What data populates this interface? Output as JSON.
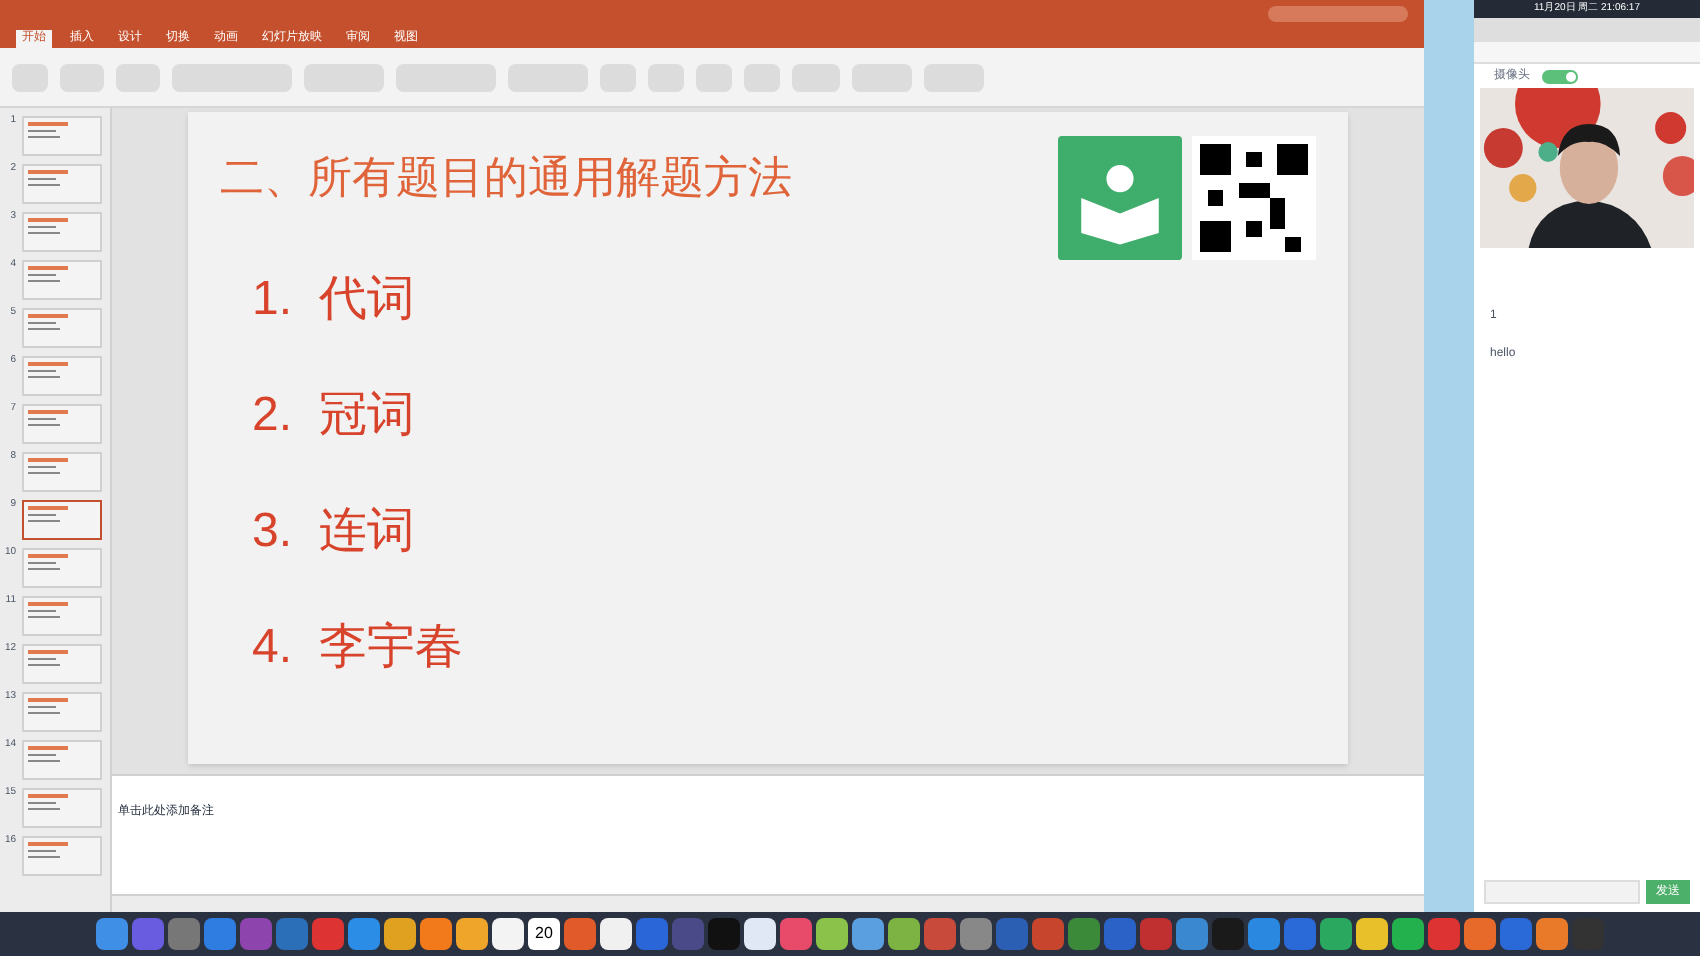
{
  "ribbon": {
    "tabs": [
      {
        "label": "开始",
        "selected": true
      },
      {
        "label": "插入",
        "selected": false
      },
      {
        "label": "设计",
        "selected": false
      },
      {
        "label": "切换",
        "selected": false
      },
      {
        "label": "动画",
        "selected": false
      },
      {
        "label": "幻灯片放映",
        "selected": false
      },
      {
        "label": "审阅",
        "selected": false
      },
      {
        "label": "视图",
        "selected": false
      }
    ]
  },
  "thumbnails": [
    {
      "number": "1",
      "selected": false
    },
    {
      "number": "2",
      "selected": false
    },
    {
      "number": "3",
      "selected": false
    },
    {
      "number": "4",
      "selected": false
    },
    {
      "number": "5",
      "selected": false
    },
    {
      "number": "6",
      "selected": false
    },
    {
      "number": "7",
      "selected": false
    },
    {
      "number": "8",
      "selected": false
    },
    {
      "number": "9",
      "selected": true
    },
    {
      "number": "10",
      "selected": false
    },
    {
      "number": "11",
      "selected": false
    },
    {
      "number": "12",
      "selected": false
    },
    {
      "number": "13",
      "selected": false
    },
    {
      "number": "14",
      "selected": false
    },
    {
      "number": "15",
      "selected": false
    },
    {
      "number": "16",
      "selected": false
    }
  ],
  "slide": {
    "title": "二、所有题目的通用解题方法",
    "items": [
      "1.  代词",
      "2.  冠词",
      "3.  连词",
      "4.  李宇春"
    ]
  },
  "notes": "单击此处添加备注",
  "menubar": {
    "datetime": "11月20日 周二 21:06:17"
  },
  "browser": {
    "camera_label": "摄像头",
    "camera_on": true,
    "messages": [
      {
        "text": "1"
      },
      {
        "text": "hello"
      }
    ],
    "send_button": "发送"
  },
  "dock": {
    "calendar_day": "20"
  }
}
